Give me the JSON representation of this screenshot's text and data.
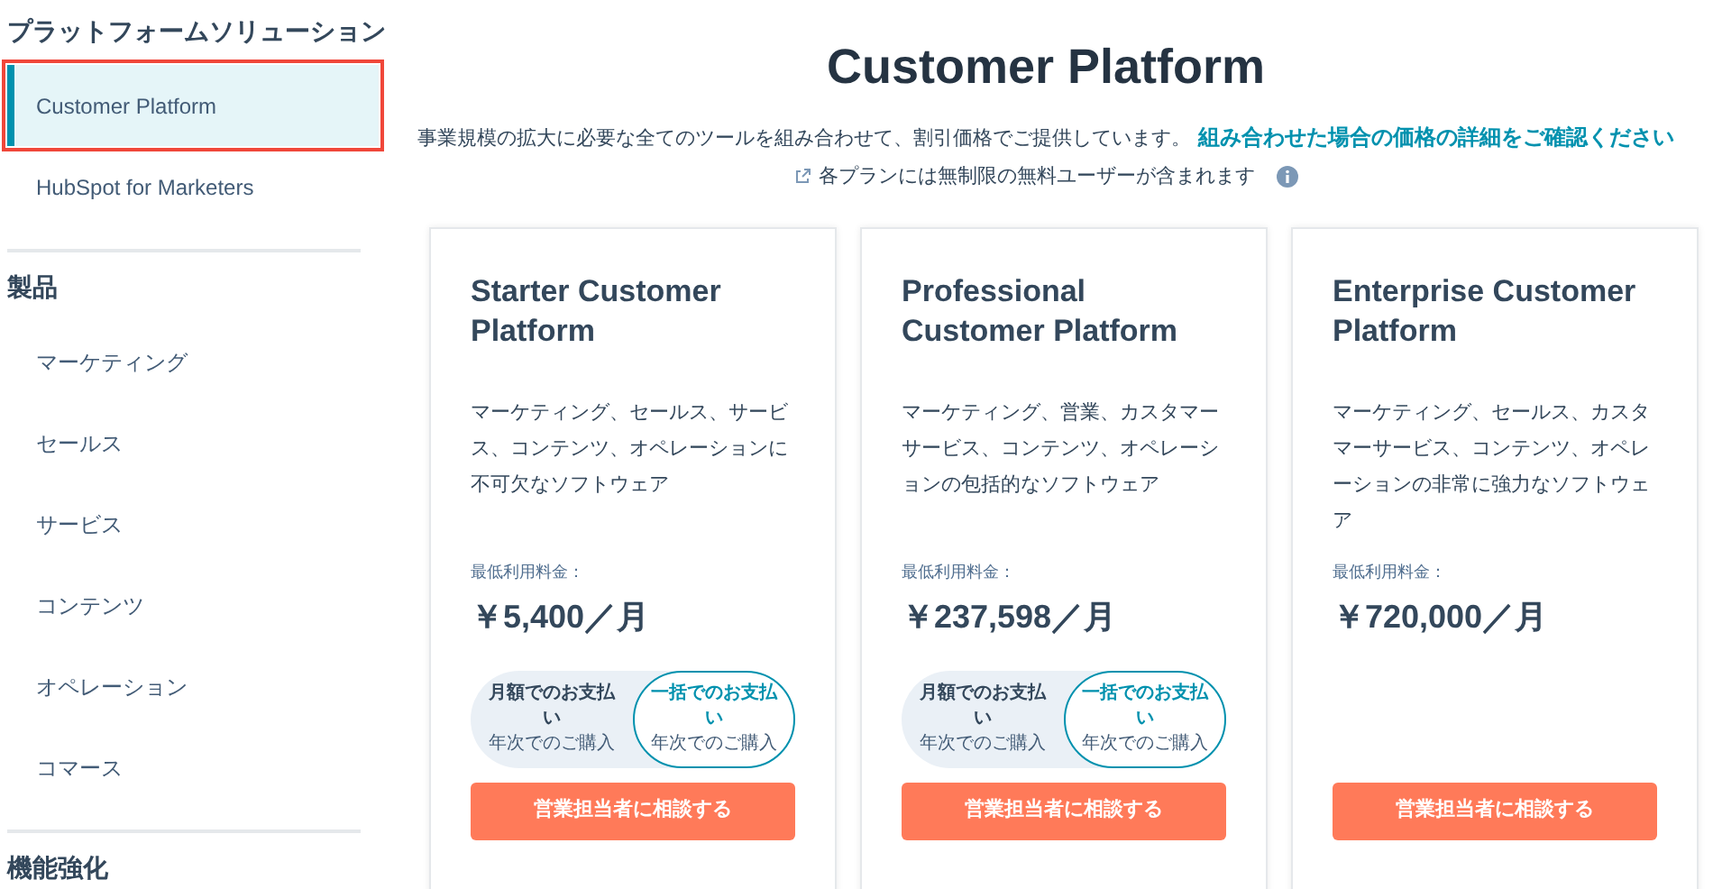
{
  "sidebar": {
    "sections": [
      {
        "heading": "プラットフォームソリューション",
        "items": [
          {
            "label": "Customer Platform",
            "selected": true,
            "highlighted": true
          },
          {
            "label": "HubSpot for Marketers",
            "selected": false,
            "highlighted": false
          }
        ]
      },
      {
        "heading": "製品",
        "items": [
          {
            "label": "マーケティング",
            "selected": false,
            "highlighted": false
          },
          {
            "label": "セールス",
            "selected": false,
            "highlighted": false
          },
          {
            "label": "サービス",
            "selected": false,
            "highlighted": false
          },
          {
            "label": "コンテンツ",
            "selected": false,
            "highlighted": false
          },
          {
            "label": "オペレーション",
            "selected": false,
            "highlighted": false
          },
          {
            "label": "コマース",
            "selected": false,
            "highlighted": false
          }
        ]
      },
      {
        "heading": "機能強化"
      }
    ]
  },
  "main": {
    "title": "Customer Platform",
    "intro": "事業規模の拡大に必要な全てのツールを組み合わせて、割引価格でご提供しています。",
    "intro_link": "組み合わせた場合の価格の詳細をご確認ください",
    "note": "各プランには無制限の無料ユーザーが含まれます",
    "plans": [
      {
        "name": "Starter Customer Platform",
        "description": "マーケティング、セールス、サービス、コンテンツ、オペレーションに不可欠なソフトウェア",
        "price_label": "最低利用料金：",
        "price": "￥5,400／月",
        "billing_options": [
          {
            "label": "月額でのお支払い",
            "sub": "年次でのご購入",
            "selected": false
          },
          {
            "label": "一括でのお支払い",
            "sub": "年次でのご購入",
            "selected": true
          }
        ],
        "button": "営業担当者に相談する"
      },
      {
        "name": "Professional Customer Platform",
        "description": "マーケティング、営業、カスタマーサービス、コンテンツ、オペレーションの包括的なソフトウェア",
        "price_label": "最低利用料金：",
        "price": "￥237,598／月",
        "billing_options": [
          {
            "label": "月額でのお支払い",
            "sub": "年次でのご購入",
            "selected": false
          },
          {
            "label": "一括でのお支払い",
            "sub": "年次でのご購入",
            "selected": true
          }
        ],
        "button": "営業担当者に相談する"
      },
      {
        "name": "Enterprise Customer Platform",
        "description": "マーケティング、セールス、カスタマーサービス、コンテンツ、オペレーションの非常に強力なソフトウェア",
        "price_label": "最低利用料金：",
        "price": "￥720,000／月",
        "button": "営業担当者に相談する"
      }
    ]
  }
}
